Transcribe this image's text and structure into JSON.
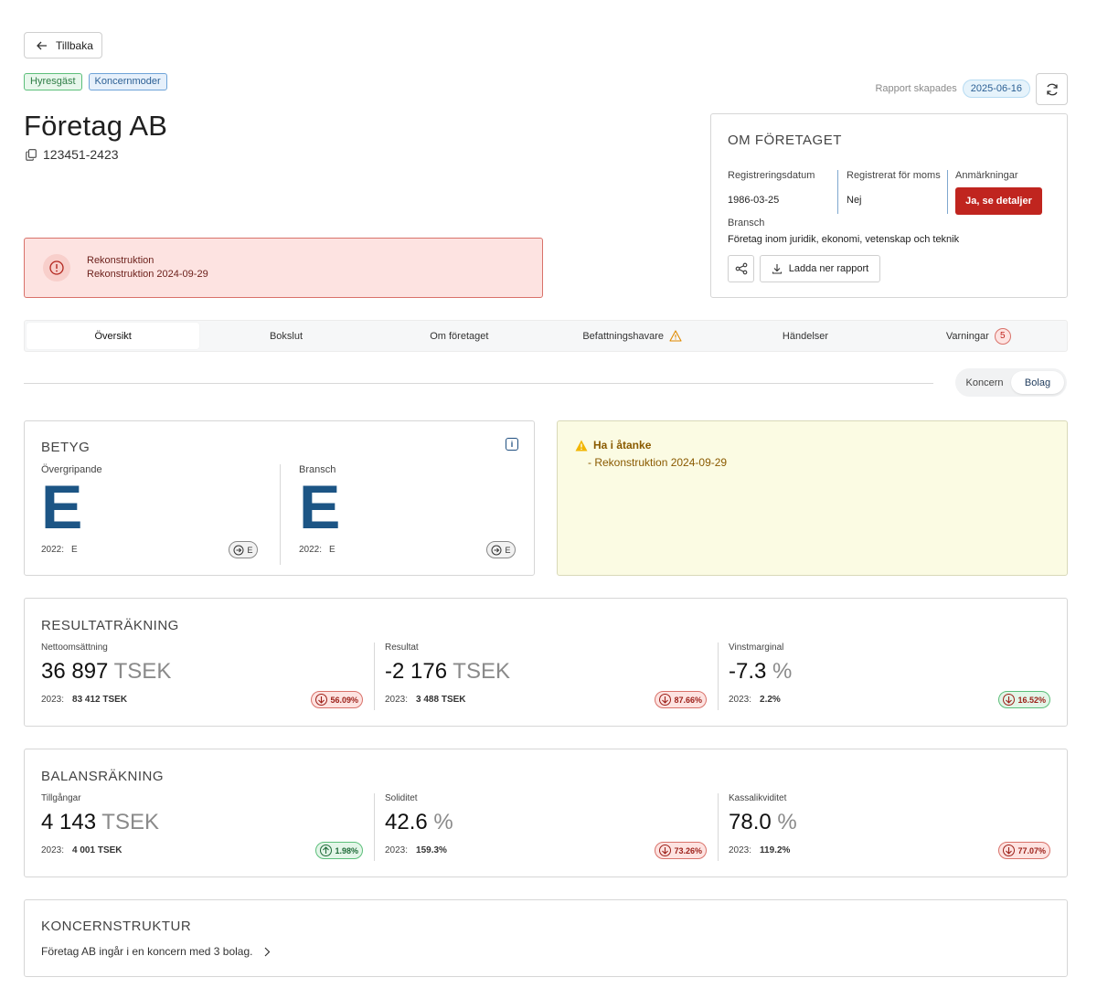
{
  "back_label": "Tillbaka",
  "tags": {
    "tenant": "Hyresgäst",
    "parent": "Koncernmoder"
  },
  "report": {
    "created_label": "Rapport skapades",
    "created_date": "2025-06-16"
  },
  "company": {
    "name": "Företag AB",
    "org_number": "123451-2423"
  },
  "alert": {
    "title": "Rekonstruktion",
    "detail": "Rekonstruktion 2024-09-29"
  },
  "about": {
    "title": "OM FÖRETAGET",
    "reg_date_label": "Registreringsdatum",
    "reg_date_value": "1986-03-25",
    "vat_label": "Registrerat för moms",
    "vat_value": "Nej",
    "remarks_label": "Anmärkningar",
    "remarks_button": "Ja, se detaljer",
    "industry_label": "Bransch",
    "industry_value": "Företag inom juridik, ekonomi, vetenskap och teknik",
    "download_label": "Ladda ner rapport"
  },
  "tabs": {
    "overview": "Översikt",
    "closing": "Bokslut",
    "about": "Om företaget",
    "officers": "Befattningshavare",
    "events": "Händelser",
    "warnings": "Varningar",
    "warnings_count": "5"
  },
  "toggle": {
    "group": "Koncern",
    "company": "Bolag"
  },
  "rating": {
    "title": "BETYG",
    "overall": {
      "label": "Övergripande",
      "grade": "E",
      "prev_year": "2022:",
      "prev_grade": "E",
      "trend_grade": "E"
    },
    "industry": {
      "label": "Bransch",
      "grade": "E",
      "prev_year": "2022:",
      "prev_grade": "E",
      "trend_grade": "E"
    }
  },
  "keep_in_mind": {
    "title": "Ha i åtanke",
    "item": "- Rekonstruktion 2024-09-29"
  },
  "income": {
    "title": "RESULTATRÄKNING",
    "net_sales": {
      "label": "Nettoomsättning",
      "value": "36 897",
      "unit": "TSEK",
      "prev_year": "2023:",
      "prev_value": "83 412 TSEK",
      "pct": "56.09%"
    },
    "result": {
      "label": "Resultat",
      "value": "-2 176",
      "unit": "TSEK",
      "prev_year": "2023:",
      "prev_value": "3 488 TSEK",
      "pct": "87.66%"
    },
    "margin": {
      "label": "Vinstmarginal",
      "value": "-7.3",
      "unit": "%",
      "prev_year": "2023:",
      "prev_value": "2.2%",
      "pct": "16.52%"
    }
  },
  "balance": {
    "title": "BALANSRÄKNING",
    "assets": {
      "label": "Tillgångar",
      "value": "4 143",
      "unit": "TSEK",
      "prev_year": "2023:",
      "prev_value": "4 001 TSEK",
      "pct": "1.98%"
    },
    "solidity": {
      "label": "Soliditet",
      "value": "42.6",
      "unit": "%",
      "prev_year": "2023:",
      "prev_value": "159.3%",
      "pct": "73.26%"
    },
    "liquidity": {
      "label": "Kassalikviditet",
      "value": "78.0",
      "unit": "%",
      "prev_year": "2023:",
      "prev_value": "119.2%",
      "pct": "77.07%"
    }
  },
  "group_structure": {
    "title": "KONCERNSTRUKTUR",
    "text": "Företag AB ingår i en koncern med 3 bolag."
  },
  "colors": {
    "accent_red": "#c0251f",
    "grade_blue": "#1c5585"
  }
}
